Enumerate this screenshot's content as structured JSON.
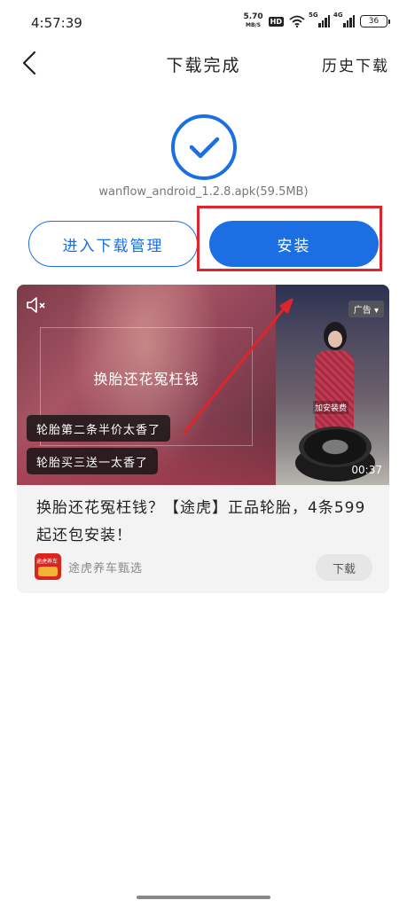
{
  "status_bar": {
    "time": "4:57:39",
    "net_speed_value": "5.70",
    "net_speed_unit": "MB/S",
    "hd_badge": "HD",
    "sim1_label": "5G",
    "sim2_label": "4G",
    "battery": "36"
  },
  "nav": {
    "back_icon": "chevron-left-icon",
    "title": "下载完成",
    "history_label": "历史下载"
  },
  "result": {
    "icon": "check-circle-icon",
    "file_name": "wanflow_android_1.2.8.apk(59.5MB)",
    "manage_button": "进入下载管理",
    "install_button": "安装",
    "accent_color": "#1c6fe3",
    "highlight_color": "#e0242b"
  },
  "ad": {
    "mute_icon": "speaker-muted-icon",
    "headline": "换胎还花冤枉钱",
    "pill1": "轮胎第二条半价太香了",
    "pill2": "轮胎买三送一太香了",
    "badge": "广告",
    "video_caption": "加安装费",
    "duration": "00:37",
    "description": "换胎还花冤枉钱？【途虎】正品轮胎，4条599起还包安装！",
    "brand_logo_text": "途虎养车",
    "brand_name": "途虎养车甄选",
    "download_button": "下载"
  }
}
